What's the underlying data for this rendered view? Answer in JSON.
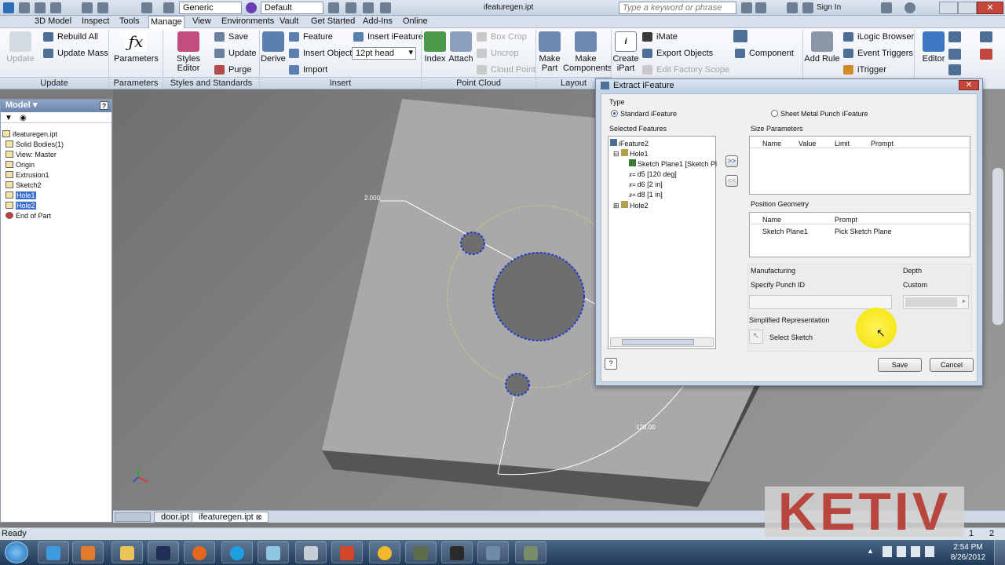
{
  "titlebar": {
    "style_combo": "Generic",
    "appearance_combo": "Default",
    "doc_title": "ifeaturegen.ipt",
    "search_placeholder": "Type a keyword or phrase",
    "signin": "Sign In"
  },
  "tabs": [
    "3D Model",
    "Inspect",
    "Tools",
    "Manage",
    "View",
    "Environments",
    "Vault",
    "Get Started",
    "Add-Ins",
    "Online"
  ],
  "active_tab": "Manage",
  "ribbon": {
    "update": {
      "update": "Update",
      "rebuild_all": "Rebuild All",
      "update_mass": "Update Mass",
      "panel": "Update"
    },
    "parameters": {
      "label": "Parameters",
      "panel": "Parameters"
    },
    "styles": {
      "styles_editor": "Styles Editor",
      "save": "Save",
      "update": "Update",
      "purge": "Purge",
      "panel": "Styles and Standards"
    },
    "insert": {
      "derive": "Derive",
      "feature": "Feature",
      "insert_object": "Insert Object",
      "import": "Import",
      "insert_ifeature": "Insert iFeature",
      "head_combo": "12pt head",
      "panel": "Insert"
    },
    "point_cloud": {
      "index": "Index",
      "attach": "Attach",
      "box_crop": "Box Crop",
      "uncrop": "Uncrop",
      "cloud_point": "Cloud Point",
      "panel": "Point Cloud"
    },
    "layout": {
      "make_part": "Make Part",
      "make_components": "Make Components",
      "panel": "Layout"
    },
    "author": {
      "create_ipart": "Create iPart",
      "imate": "iMate",
      "export_objects": "Export Objects",
      "edit_factory_scope": "Edit Factory Scope",
      "component": "Component"
    },
    "ilogic": {
      "add_rule": "Add Rule",
      "ilogic_browser": "iLogic Browser",
      "event_triggers": "Event Triggers",
      "itrigger": "iTrigger"
    },
    "editor": {
      "label": "Editor"
    }
  },
  "browser": {
    "title": "Model",
    "items": [
      {
        "label": "ifeaturegen.ipt",
        "indent": 0,
        "selected": false
      },
      {
        "label": "Solid Bodies(1)",
        "indent": 1,
        "selected": false
      },
      {
        "label": "View: Master",
        "indent": 1,
        "selected": false
      },
      {
        "label": "Origin",
        "indent": 1,
        "selected": false
      },
      {
        "label": "Extrusion1",
        "indent": 1,
        "selected": false
      },
      {
        "label": "Sketch2",
        "indent": 1,
        "selected": false
      },
      {
        "label": "Hole1",
        "indent": 1,
        "selected": true
      },
      {
        "label": "Hole2",
        "indent": 1,
        "selected": true
      },
      {
        "label": "End of Part",
        "indent": 1,
        "selected": false
      }
    ]
  },
  "viewport": {
    "dim_top": "2.000",
    "dim_angle": "120.00"
  },
  "doctabs": [
    "door.ipt",
    "ifeaturegen.ipt"
  ],
  "status": {
    "text": "Ready",
    "page_left": "1",
    "page_right": "2"
  },
  "clock": {
    "time": "2:54 PM",
    "date": "8/26/2012"
  },
  "watermark": "KETIV",
  "dialog": {
    "title": "Extract iFeature",
    "type_label": "Type",
    "standard": "Standard iFeature",
    "sheet_metal": "Sheet Metal Punch iFeature",
    "selected_features": "Selected Features",
    "tree": [
      "iFeature2",
      "Hole1",
      "Sketch Plane1 [Sketch Pl",
      "d5 [120 deg]",
      "d6 [2 in]",
      "d8 [1 in]",
      "Hole2"
    ],
    "size_parameters": "Size Parameters",
    "size_cols": [
      "Name",
      "Value",
      "Limit",
      "Prompt"
    ],
    "position_geometry": "Position Geometry",
    "pos_cols": [
      "Name",
      "Prompt"
    ],
    "pos_row": {
      "name": "Sketch Plane1",
      "prompt": "Pick Sketch Plane"
    },
    "manufacturing": "Manufacturing",
    "specify_punch_id": "Specify Punch ID",
    "depth": "Depth",
    "custom": "Custom",
    "simplified": "Simplified Representation",
    "select_sketch": "Select Sketch",
    "add": ">>",
    "remove": "<<",
    "save": "Save",
    "cancel": "Cancel"
  }
}
